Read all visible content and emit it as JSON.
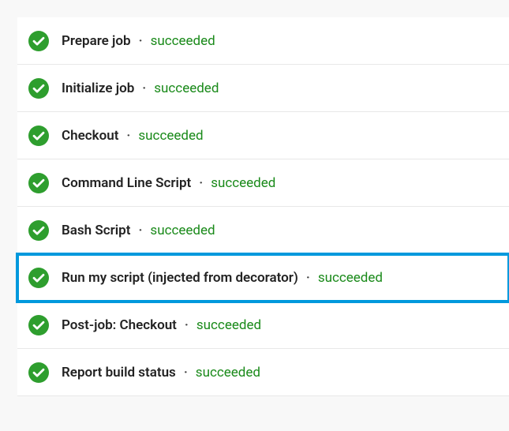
{
  "separator": "·",
  "status_label": "succeeded",
  "steps": [
    {
      "name": "Prepare job",
      "status": "succeeded",
      "highlighted": false
    },
    {
      "name": "Initialize job",
      "status": "succeeded",
      "highlighted": false
    },
    {
      "name": "Checkout",
      "status": "succeeded",
      "highlighted": false
    },
    {
      "name": "Command Line Script",
      "status": "succeeded",
      "highlighted": false
    },
    {
      "name": "Bash Script",
      "status": "succeeded",
      "highlighted": false
    },
    {
      "name": "Run my script (injected from decorator)",
      "status": "succeeded",
      "highlighted": true
    },
    {
      "name": "Post-job: Checkout",
      "status": "succeeded",
      "highlighted": false
    },
    {
      "name": "Report build status",
      "status": "succeeded",
      "highlighted": false
    }
  ],
  "colors": {
    "success": "#2e9e2e",
    "highlight_border": "#0099dd"
  }
}
